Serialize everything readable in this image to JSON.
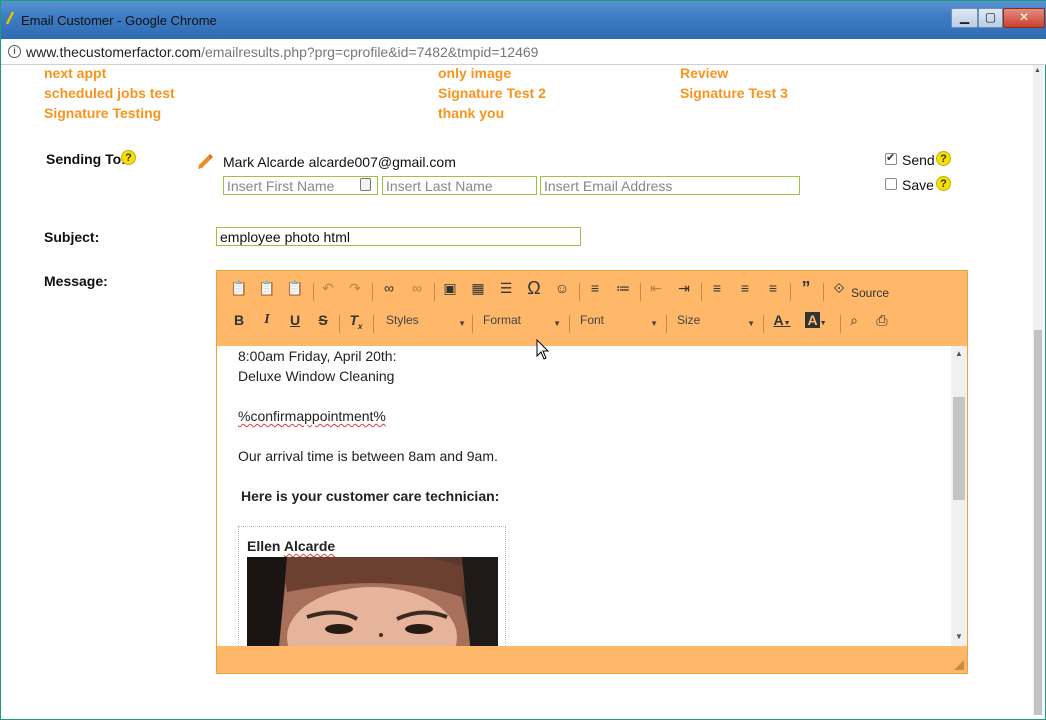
{
  "window": {
    "title": "Email Customer - Google Chrome",
    "url_host": "www.thecustomerfactor.com",
    "url_path": "/emailresults.php?prg=cprofile&id=7482&tmpid=12469",
    "buttons": {
      "minimize": "▁",
      "maximize": "▢",
      "close": "✕"
    }
  },
  "templates": {
    "col1": [
      "next appt",
      "scheduled jobs test",
      "Signature Testing"
    ],
    "col2": [
      "only image",
      "Signature Test 2",
      "thank you"
    ],
    "col3": [
      "Review",
      "Signature Test 3"
    ]
  },
  "sending": {
    "label": "Sending To:",
    "help": "?",
    "recipient": "Mark Alcarde alcarde007@gmail.com",
    "first_name_placeholder": "Insert First Name",
    "last_name_placeholder": "Insert Last Name",
    "email_placeholder": "Insert Email Address",
    "send_label": "Send",
    "save_label": "Save",
    "send_checked": true,
    "save_checked": false
  },
  "subject": {
    "label": "Subject:",
    "value": "employee photo html"
  },
  "message": {
    "label": "Message:",
    "toolbar": {
      "source_label": "Source",
      "styles": "Styles",
      "format": "Format",
      "font": "Font",
      "size": "Size"
    },
    "body": {
      "line1": "8:00am Friday, April 20th:",
      "line2": "Deluxe Window Cleaning",
      "line3": "%confirmappointment%",
      "line4": "Our arrival time is between 8am and 9am.",
      "line5": "Here is your customer care technician:",
      "tech_name_first": "Ellen ",
      "tech_name_last": "Alcarde"
    }
  },
  "colors": {
    "link": "#f7941d",
    "editor_chrome": "#ffb869",
    "field_border": "#9ac243",
    "background": "#1fbf95"
  }
}
